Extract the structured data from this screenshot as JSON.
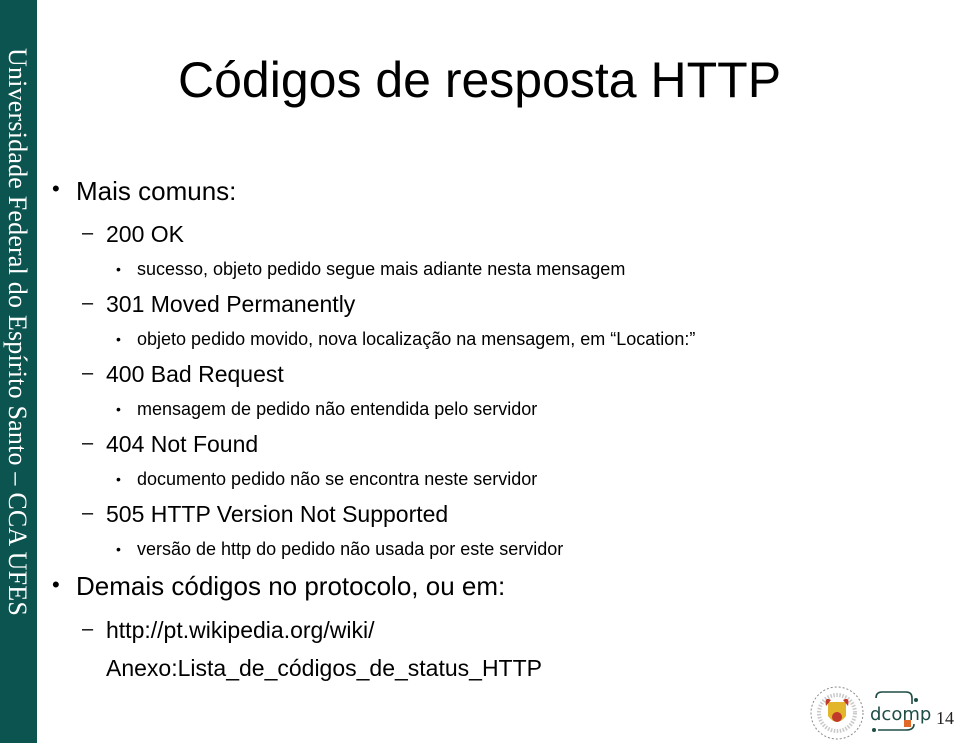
{
  "sidebar": {
    "text": "Universidade Federal do Espírito Santo – CCA UFES",
    "color": "#0b5450"
  },
  "slide": {
    "title": "Códigos de resposta HTTP",
    "bullets": [
      {
        "text": "Mais comuns:"
      },
      {
        "code": "200 OK",
        "detail": "sucesso, objeto pedido segue mais adiante nesta mensagem"
      },
      {
        "code": "301 Moved Permanently",
        "detail": "objeto pedido movido, nova localização na mensagem, em “Location:”"
      },
      {
        "code": "400 Bad Request",
        "detail": "mensagem de pedido não entendida pelo servidor"
      },
      {
        "code": "404 Not Found",
        "detail": "documento pedido não se encontra neste servidor"
      },
      {
        "code": "505 HTTP Version Not Supported",
        "detail": "versão de http do pedido não usada por este servidor"
      },
      {
        "text": "Demais códigos no protocolo, ou em:"
      },
      {
        "link_line1": "http://pt.wikipedia.org/wiki/",
        "link_line2": "Anexo:Lista_de_códigos_de_status_HTTP"
      }
    ],
    "bullet_glyph": "•",
    "dash_glyph": "–"
  },
  "footer": {
    "page_number": "14",
    "logo_ufes": "UFES seal",
    "logo_dcomp": "dcomp"
  }
}
